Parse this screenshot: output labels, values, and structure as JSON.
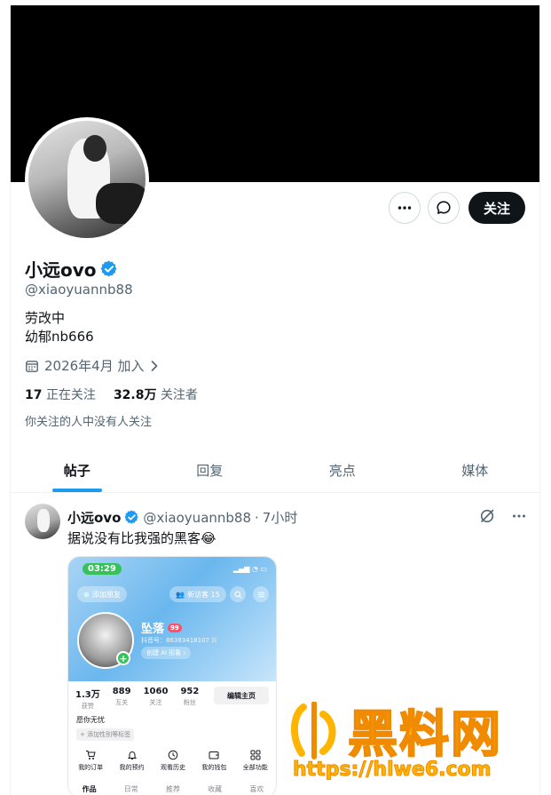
{
  "profile": {
    "display_name": "小远ovo",
    "handle": "@xiaoyuannb88",
    "bio_line1": "劳改中",
    "bio_line2": "幼郁nb666",
    "joined": "2026年4月 加入",
    "following_count": "17",
    "following_label": "正在关注",
    "followers_count": "32.8万",
    "followers_label": "关注者",
    "mutual_note": "你关注的人中没有人关注"
  },
  "actions": {
    "more_icon": "more-horizontal-icon",
    "message_icon": "message-icon",
    "follow_label": "关注"
  },
  "colors": {
    "accent": "#1d9bf0",
    "verified": "#1d9bf0",
    "follow_button": "#0f1419",
    "watermark": "#ffb400"
  },
  "tabs": [
    {
      "label": "帖子",
      "active": true
    },
    {
      "label": "回复",
      "active": false
    },
    {
      "label": "亮点",
      "active": false
    },
    {
      "label": "媒体",
      "active": false
    }
  ],
  "post": {
    "author_name": "小远ovo",
    "author_handle": "@xiaoyuannb88",
    "separator": "·",
    "time": "7小时",
    "text": "据说没有比我强的黑客😂",
    "embedded_screenshot": {
      "time": "03:29",
      "add_friend": "添加朋友",
      "new_visitors": "新访客 15",
      "name": "坠落",
      "badge": "99",
      "id_line": "抖音号：86383418107 ☷",
      "ai_button": "创建 AI 形象 ›",
      "stats": [
        {
          "value": "1.3万",
          "label": "获赞"
        },
        {
          "value": "889",
          "label": "互关"
        },
        {
          "value": "1060",
          "label": "关注"
        },
        {
          "value": "952",
          "label": "粉丝"
        }
      ],
      "edit_button": "编辑主页",
      "signature": "愿你无忧",
      "add_tag": "+ 添加性别等标签",
      "quick_actions": [
        {
          "label": "我的订单",
          "icon": "cart-icon"
        },
        {
          "label": "我的预约",
          "icon": "bell-icon"
        },
        {
          "label": "观看历史",
          "icon": "clock-icon"
        },
        {
          "label": "我的钱包",
          "icon": "wallet-icon"
        },
        {
          "label": "全部功能",
          "icon": "grid-icon"
        }
      ],
      "tabs": [
        "作品",
        "日常",
        "推荐",
        "收藏",
        "喜欢"
      ]
    }
  },
  "watermark": {
    "title": "黑料网",
    "url": "https://hlwe6.com"
  }
}
